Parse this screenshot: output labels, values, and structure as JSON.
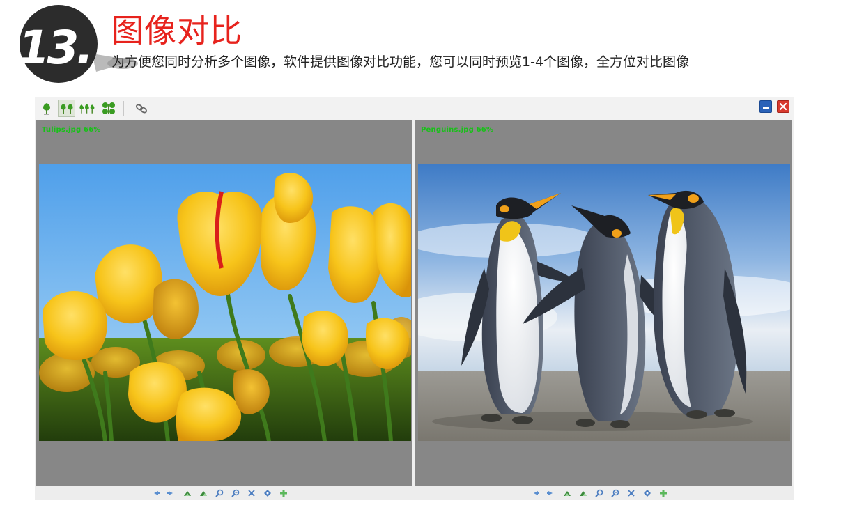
{
  "badge": {
    "number": "13."
  },
  "header": {
    "title": "图像对比",
    "subtitle": "为方便您同时分析多个图像，软件提供图像对比功能，您可以同时预览1-4个图像，全方位对比图像"
  },
  "colors": {
    "title_red": "#e7231d",
    "label_green": "#18c018",
    "panel_gray": "#878787",
    "minimize_blue": "#2a62b8",
    "close_red": "#d83a2e"
  },
  "toolbar": {
    "layout_buttons": [
      {
        "icon": "single-tree-icon",
        "active": false
      },
      {
        "icon": "two-trees-icon",
        "active": true
      },
      {
        "icon": "three-trees-icon",
        "active": false
      },
      {
        "icon": "four-trees-icon",
        "active": false
      }
    ],
    "link_button": {
      "icon": "link-chain-icon"
    },
    "window_buttons": [
      "minimize-icon",
      "close-icon"
    ]
  },
  "panels": {
    "left": {
      "label": "Tulips.jpg  66%",
      "image": "tulips-photo"
    },
    "right": {
      "label": "Penguins.jpg  66%",
      "image": "penguins-photo"
    }
  },
  "nav_icons": [
    "previous-arrow-icon",
    "next-arrow-icon",
    "rotate-left-icon",
    "rotate-right-icon",
    "zoom-in-icon",
    "zoom-out-icon",
    "fit-to-window-icon",
    "actual-size-icon",
    "add-icon"
  ]
}
